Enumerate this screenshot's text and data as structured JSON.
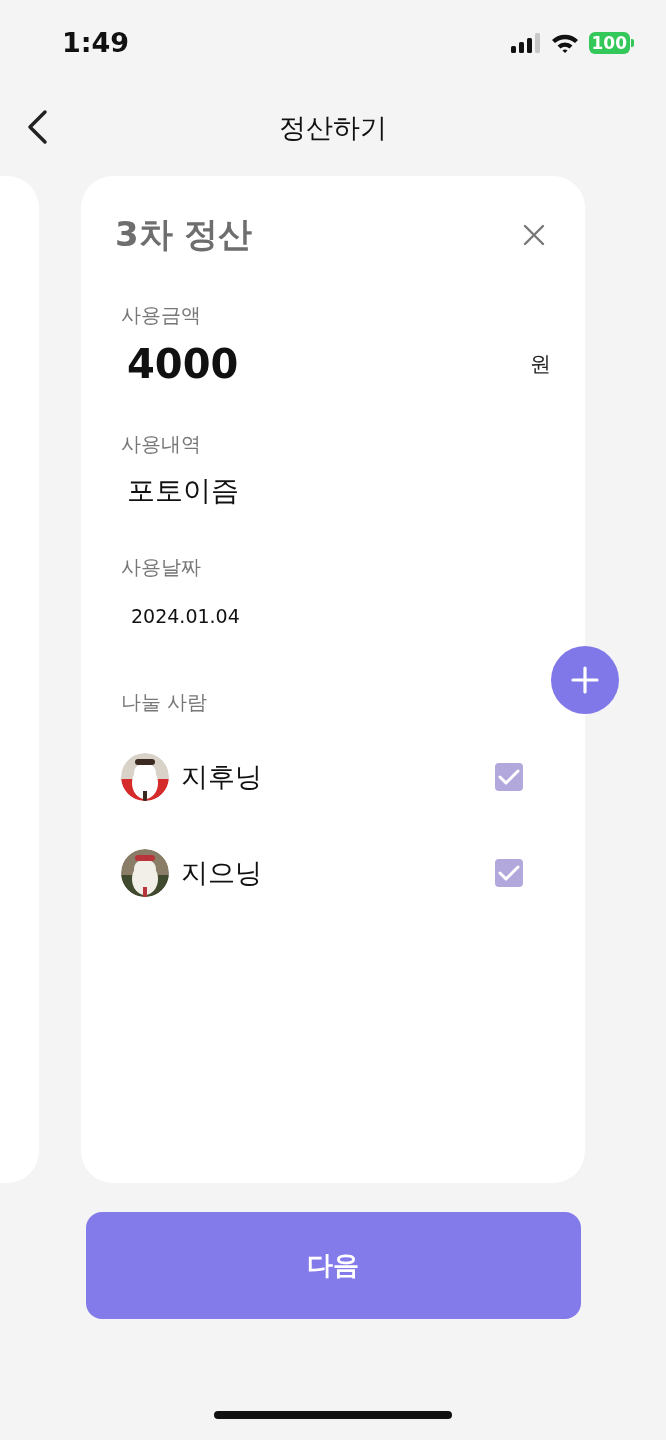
{
  "status_bar": {
    "time": "1:49",
    "battery": "100"
  },
  "nav": {
    "title": "정산하기"
  },
  "card": {
    "title": "3차 정산",
    "amount": {
      "label": "사용금액",
      "value": "4000",
      "unit": "원"
    },
    "description": {
      "label": "사용내역",
      "value": "포토이즘"
    },
    "date": {
      "label": "사용날짜",
      "value": "2024.01.04"
    },
    "members_label": "나눌 사람",
    "members": [
      {
        "name": "지후닝",
        "checked": true,
        "kind": "picture"
      },
      {
        "name": "지으닝",
        "checked": true,
        "kind": "picture"
      }
    ]
  },
  "next_button": "다음"
}
